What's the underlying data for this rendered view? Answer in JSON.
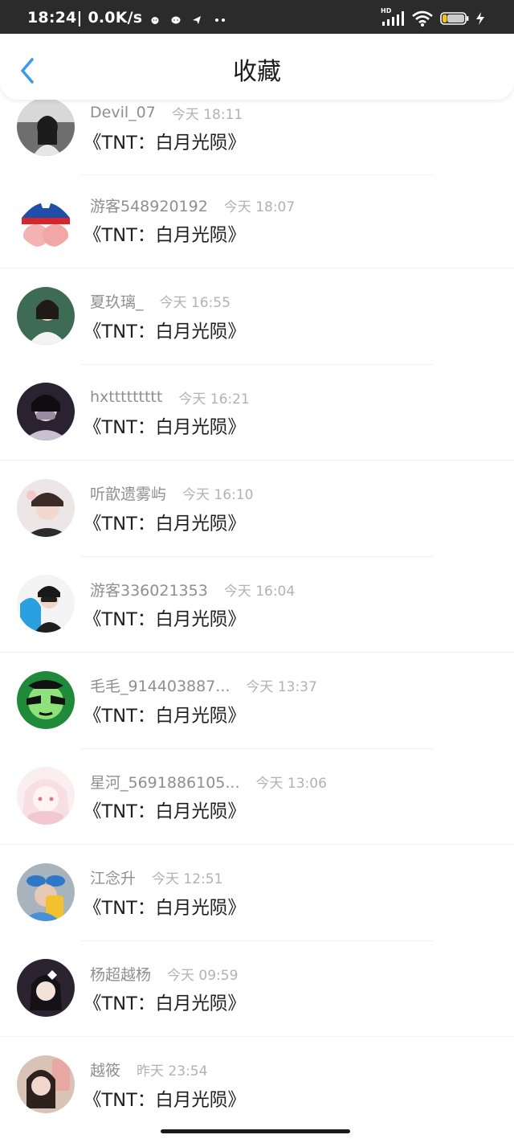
{
  "status_bar": {
    "time": "18:24",
    "speed": " | 0.0K/s",
    "network_badge": "HD",
    "battery_level": 0.2,
    "icons": [
      "piggy-icon",
      "chat-bubble-icon",
      "send-icon",
      "more-dots-icon",
      "signal-icon",
      "wifi-icon",
      "battery-icon",
      "charging-icon"
    ]
  },
  "header": {
    "title": "收藏",
    "back_icon": "chevron-left-icon"
  },
  "colors": {
    "accent": "#3d9be9",
    "status_bar_bg": "#2b2b2b",
    "name_text": "#8f8f8f",
    "time_text": "#b2b2b2",
    "title_text": "#1e1e1e"
  },
  "favorites": [
    {
      "name": "Devil_07",
      "time": "今天 18:11",
      "title": "《TNT：白月光陨》"
    },
    {
      "name": "游客548920192",
      "time": "今天 18:07",
      "title": "《TNT：白月光陨》"
    },
    {
      "name": "夏玖璃_",
      "time": "今天 16:55",
      "title": "《TNT：白月光陨》"
    },
    {
      "name": "hxttttttttt",
      "time": "今天 16:21",
      "title": "《TNT：白月光陨》"
    },
    {
      "name": "听歆遗雾屿",
      "time": "今天 16:10",
      "title": "《TNT：白月光陨》"
    },
    {
      "name": "游客336021353",
      "time": "今天 16:04",
      "title": "《TNT：白月光陨》"
    },
    {
      "name": "毛毛_914403887...",
      "time": "今天 13:37",
      "title": "《TNT：白月光陨》"
    },
    {
      "name": "星河_5691886105...",
      "time": "今天 13:06",
      "title": "《TNT：白月光陨》"
    },
    {
      "name": "江念升",
      "time": "今天 12:51",
      "title": "《TNT：白月光陨》"
    },
    {
      "name": "杨超越杨",
      "time": "今天 09:59",
      "title": "《TNT：白月光陨》"
    },
    {
      "name": "越筱",
      "time": "昨天 23:54",
      "title": "《TNT：白月光陨》"
    }
  ]
}
